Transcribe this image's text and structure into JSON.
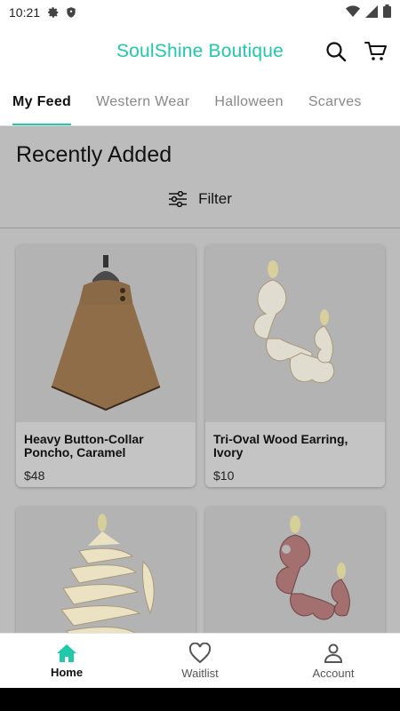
{
  "status": {
    "time": "10:21",
    "icons": [
      "gear-icon",
      "shield-icon",
      "wifi-icon",
      "signal-icon",
      "battery-icon"
    ]
  },
  "app": {
    "title": "SoulShine Boutique",
    "brand_color": "#1fc9a9",
    "actions": [
      "search-icon",
      "cart-icon"
    ]
  },
  "tabs": [
    {
      "label": "My Feed",
      "active": true
    },
    {
      "label": "Western Wear"
    },
    {
      "label": "Halloween"
    },
    {
      "label": "Scarves"
    }
  ],
  "section": {
    "title": "Recently Added",
    "filter_label": "Filter",
    "filter_icon": "sliders-icon"
  },
  "products": [
    {
      "name": "Heavy Button-Collar Poncho, Caramel",
      "price": "$48"
    },
    {
      "name": "Tri-Oval Wood Earring, Ivory",
      "price": "$10"
    },
    {
      "name": "",
      "price": ""
    },
    {
      "name": "",
      "price": ""
    }
  ],
  "bottom_nav": [
    {
      "label": "Home",
      "icon": "home-icon",
      "active": true
    },
    {
      "label": "Waitlist",
      "icon": "heart-icon"
    },
    {
      "label": "Account",
      "icon": "person-icon"
    }
  ]
}
